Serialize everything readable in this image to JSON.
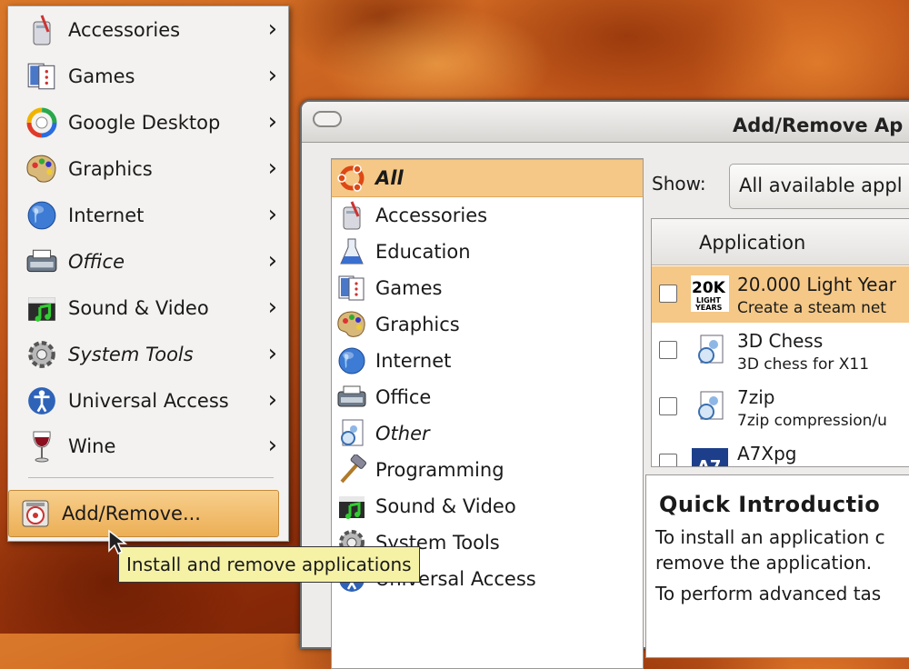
{
  "window": {
    "title": "Add/Remove Ap"
  },
  "categories": [
    {
      "label": "All",
      "icon": "ubuntu-logo-icon",
      "selected": true,
      "bold": true
    },
    {
      "label": "Accessories",
      "icon": "accessories-icon"
    },
    {
      "label": "Education",
      "icon": "education-flask-icon"
    },
    {
      "label": "Games",
      "icon": "games-cards-icon"
    },
    {
      "label": "Graphics",
      "icon": "graphics-palette-icon"
    },
    {
      "label": "Internet",
      "icon": "internet-globe-icon"
    },
    {
      "label": "Office",
      "icon": "office-typewriter-icon"
    },
    {
      "label": "Other",
      "icon": "other-icon",
      "italic": true
    },
    {
      "label": "Programming",
      "icon": "programming-hammer-icon"
    },
    {
      "label": "Sound & Video",
      "icon": "sound-video-icon"
    },
    {
      "label": "System Tools",
      "icon": "system-tools-gear-icon"
    },
    {
      "label": "Universal Access",
      "icon": "universal-access-icon"
    }
  ],
  "show": {
    "label": "Show:",
    "value": "All available appl"
  },
  "app_list": {
    "header": "Application",
    "rows": [
      {
        "name": "20.000 Light Year",
        "desc": "Create a steam net",
        "icon": "20k-light-years-icon",
        "selected": true
      },
      {
        "name": "3D Chess",
        "desc": "3D chess for X11",
        "icon": "package-icon"
      },
      {
        "name": "7zip",
        "desc": "7zip compression/u",
        "icon": "package-icon"
      },
      {
        "name": "A7Xpg",
        "desc": "",
        "icon": "a7xpg-icon"
      }
    ]
  },
  "intro": {
    "title": "Quick Introductio",
    "line1": "To install an application c",
    "line2": "remove the application.",
    "line3": "To perform advanced tas"
  },
  "menu": {
    "items": [
      {
        "label": "Accessories",
        "icon": "accessories-icon",
        "italic": false
      },
      {
        "label": "Games",
        "icon": "games-cards-icon",
        "italic": false
      },
      {
        "label": "Google Desktop",
        "icon": "google-desktop-icon",
        "italic": false
      },
      {
        "label": "Graphics",
        "icon": "graphics-palette-icon",
        "italic": false
      },
      {
        "label": "Internet",
        "icon": "internet-globe-icon",
        "italic": false
      },
      {
        "label": "Office",
        "icon": "office-typewriter-icon",
        "italic": true
      },
      {
        "label": "Sound & Video",
        "icon": "sound-video-icon",
        "italic": false
      },
      {
        "label": "System Tools",
        "icon": "system-tools-gear-icon",
        "italic": true
      },
      {
        "label": "Universal Access",
        "icon": "universal-access-icon",
        "italic": false
      },
      {
        "label": "Wine",
        "icon": "wine-glass-icon",
        "italic": false
      }
    ],
    "submenu_arrow": "›",
    "add_remove_label": "Add/Remove..."
  },
  "tooltip": "Install and remove applications",
  "colors": {
    "selection": "#f5c887",
    "menu_bg": "#f3f2f0",
    "tooltip_bg": "#f5f2a6"
  }
}
